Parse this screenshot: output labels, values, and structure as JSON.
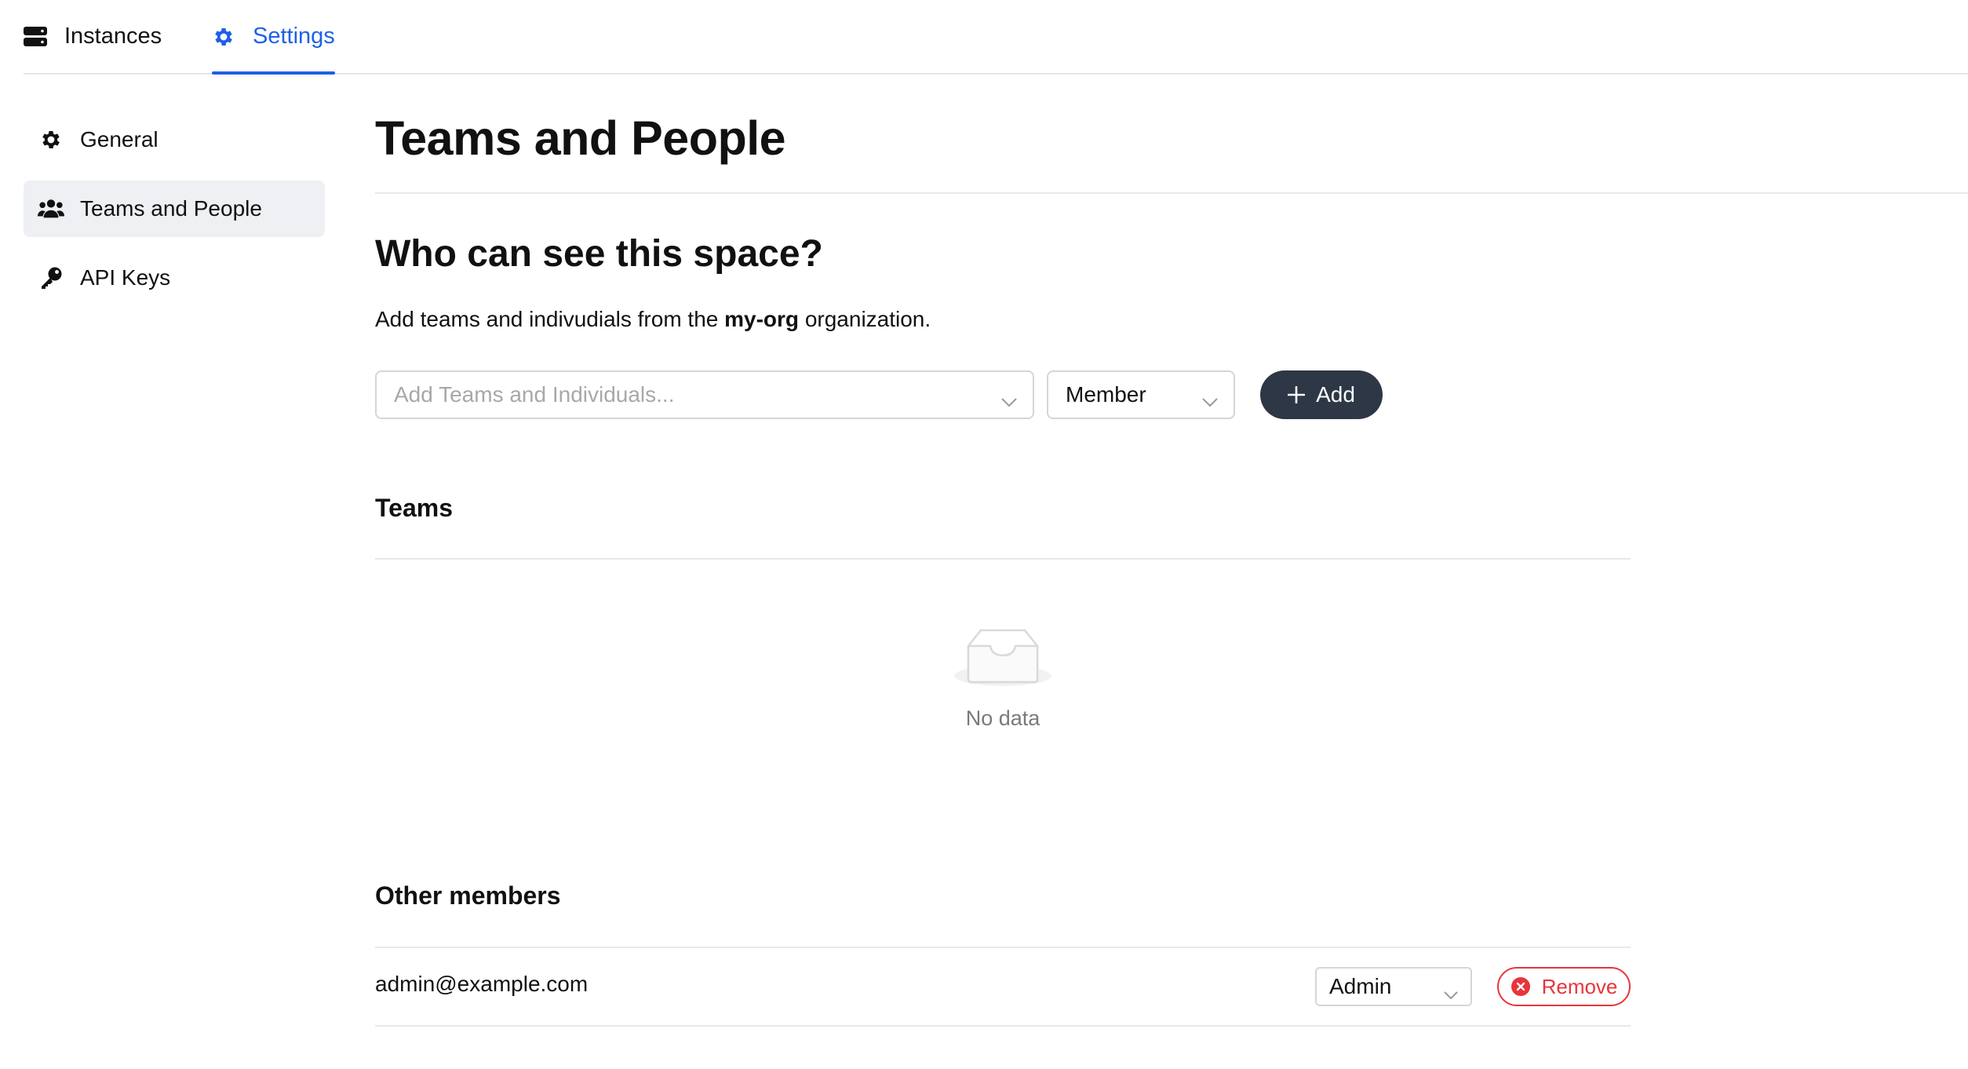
{
  "topnav": {
    "tabs": [
      {
        "label": "Instances",
        "icon": "server-icon",
        "active": false
      },
      {
        "label": "Settings",
        "icon": "gear-icon",
        "active": true
      }
    ],
    "active_color": "#1f5fe8"
  },
  "sidebar": {
    "items": [
      {
        "label": "General",
        "icon": "gear-icon",
        "active": false
      },
      {
        "label": "Teams and People",
        "icon": "users-icon",
        "active": true
      },
      {
        "label": "API Keys",
        "icon": "key-icon",
        "active": false
      }
    ]
  },
  "main": {
    "title": "Teams and People",
    "section_title": "Who can see this space?",
    "description": {
      "prefix": "Add teams and indivudials from the ",
      "org": "my-org",
      "suffix": " organization."
    },
    "add_form": {
      "search_placeholder": "Add Teams and Individuals...",
      "role_value": "Member",
      "add_label": "Add"
    },
    "teams": {
      "heading": "Teams",
      "empty_text": "No data"
    },
    "other_members": {
      "heading": "Other members",
      "rows": [
        {
          "email": "admin@example.com",
          "role": "Admin",
          "remove_label": "Remove"
        }
      ]
    }
  },
  "colors": {
    "accent": "#1f5fe8",
    "add_button_bg": "#2e3745",
    "danger": "#e8353b",
    "sidebar_active_bg": "#eef0f3"
  }
}
